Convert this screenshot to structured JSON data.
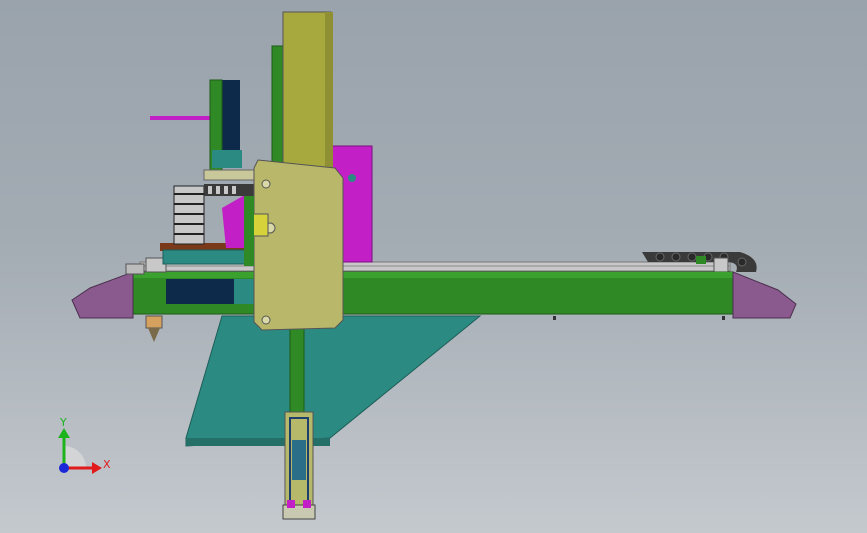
{
  "triad": {
    "x_label": "X",
    "y_label": "Y"
  },
  "colors": {
    "frame_green": "#2f8a25",
    "column_olive": "#a7a93e",
    "carriage_khaki": "#b9b86a",
    "base_teal": "#2b8b82",
    "motor_magenta": "#c21fc6",
    "end_cap_mauve": "#8a5a8e",
    "rail_grey": "#c8c8c8",
    "chain_dark": "#3a3a3a",
    "triad_x": "#e11b1b",
    "triad_y": "#1db31d",
    "triad_z": "#1a28d8"
  }
}
